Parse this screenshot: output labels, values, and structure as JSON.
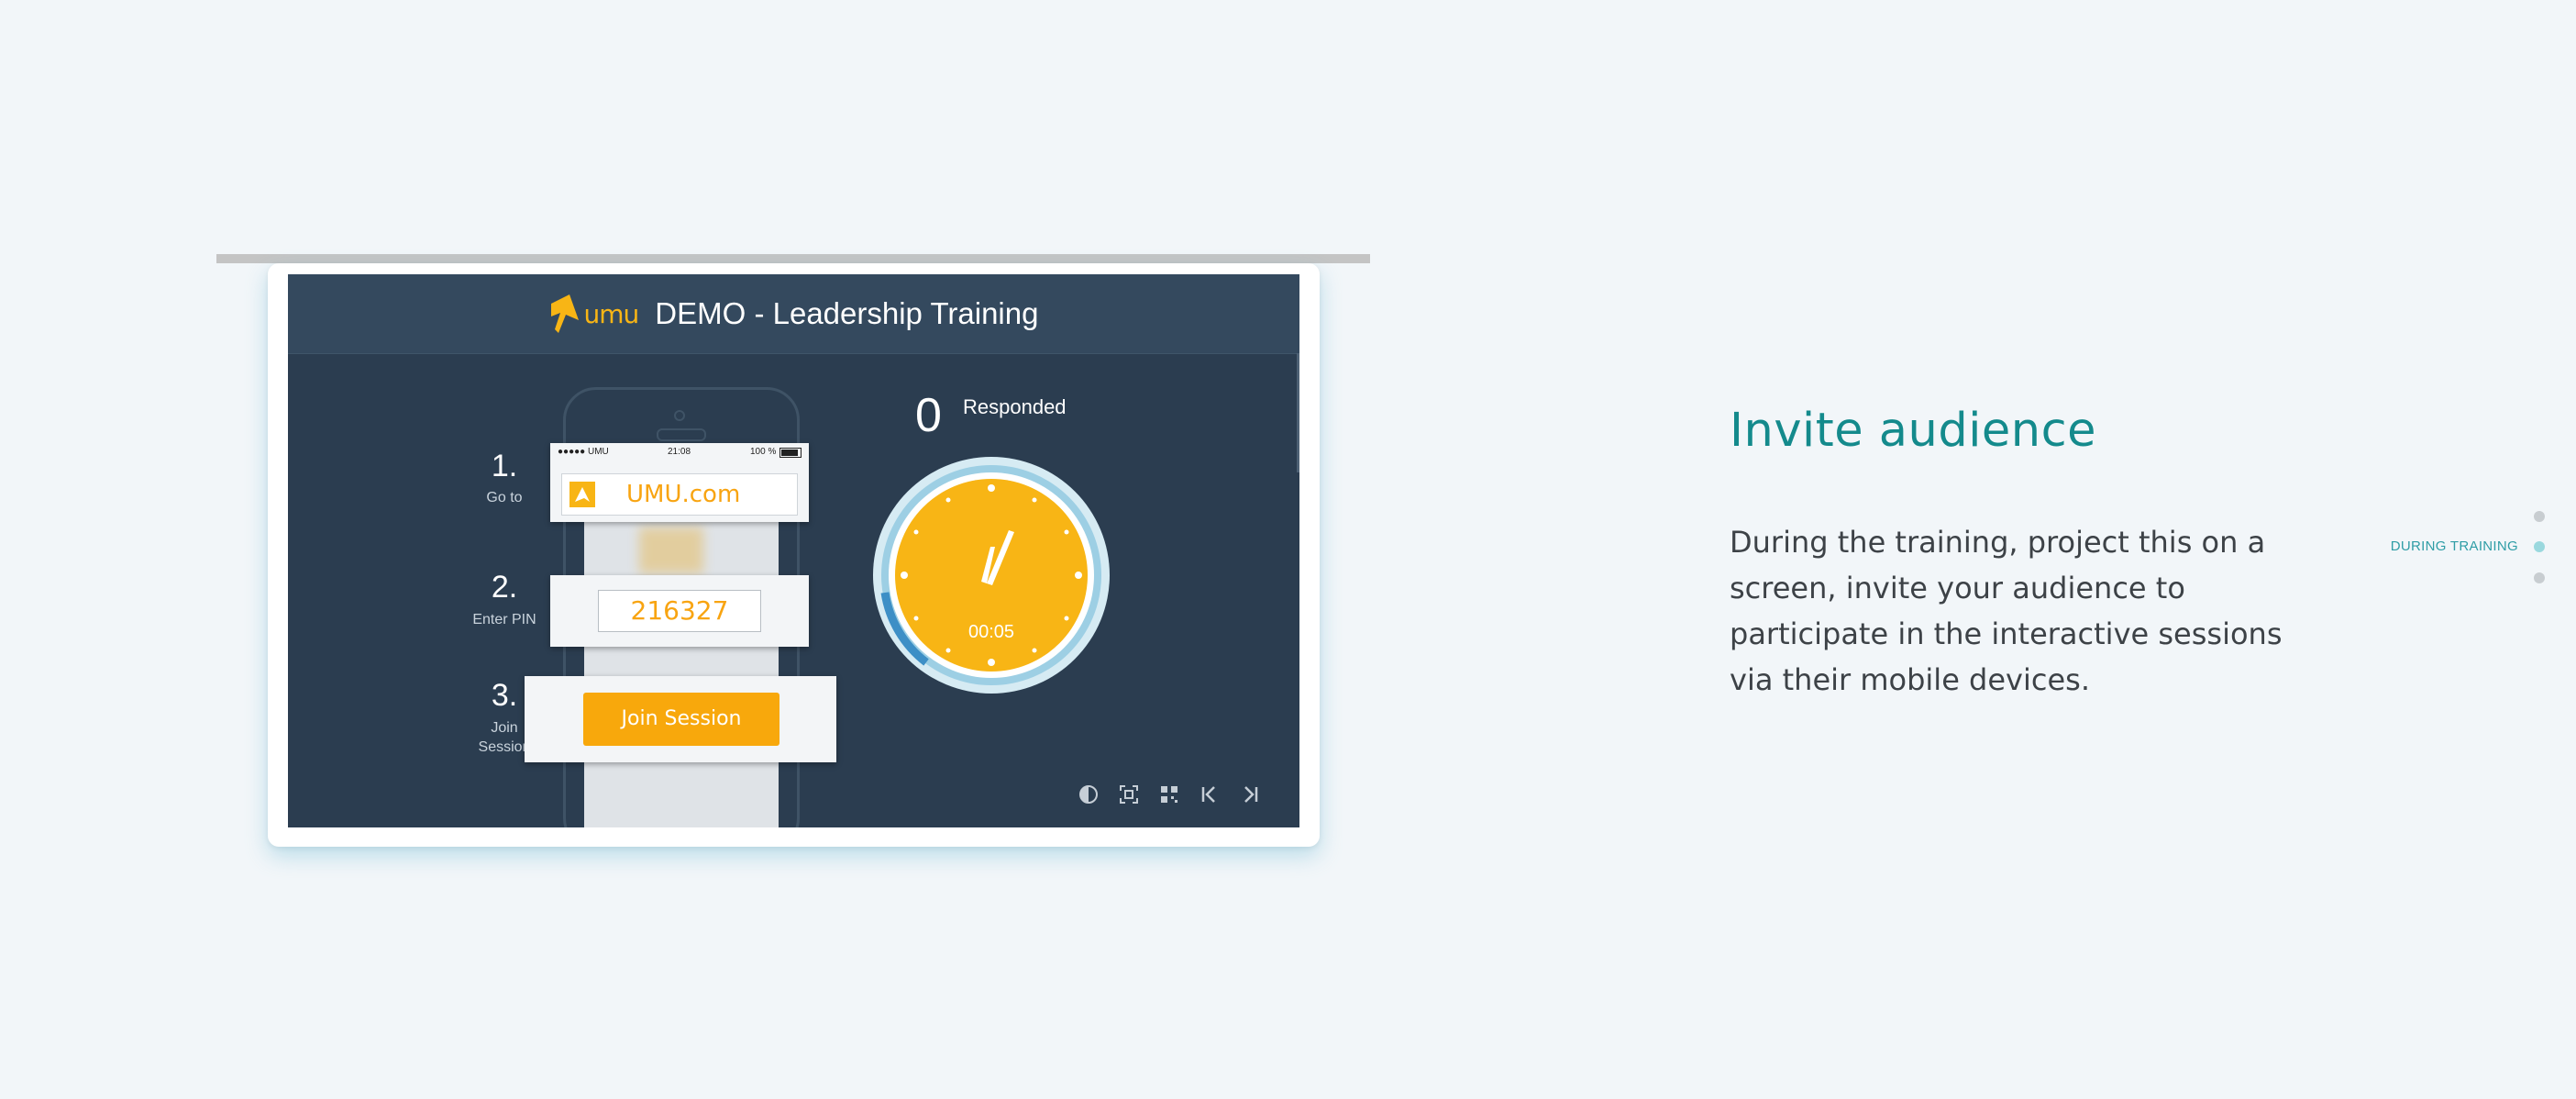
{
  "screen": {
    "logo_text": "umu",
    "title": "DEMO - Leadership Training",
    "steps": [
      {
        "num": "1.",
        "label": "Go to"
      },
      {
        "num": "2.",
        "label": "Enter PIN"
      },
      {
        "num": "3.",
        "label": "Join Session"
      }
    ],
    "phone_status": {
      "carrier": "●●●●● UMU",
      "time": "21:08",
      "battery": "100 %"
    },
    "url": "UMU.com",
    "pin": "216327",
    "join_button": "Join Session",
    "responded_count": "0",
    "responded_label": "Responded",
    "timer": "00:05",
    "accent_color": "#f8b515"
  },
  "section": {
    "heading": "Invite audience",
    "body": "During the training, project this on a screen, invite your audience to participate in the interactive sessions via their mobile devices."
  },
  "side_nav": {
    "active_label": "DURING TRAINING"
  }
}
